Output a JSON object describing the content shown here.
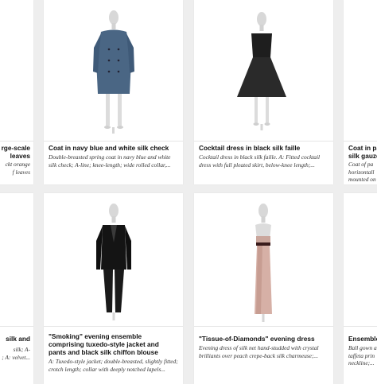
{
  "row1": [
    {
      "title": "rge-scale\nleaves",
      "desc": "ckt orange\nf leaves"
    },
    {
      "title": "Coat in navy blue and white silk check",
      "desc": "Double-breasted spring coat in navy blue and white silk check; A-line; knee-length; wide rolled collar,..."
    },
    {
      "title": "Cocktail dress in black silk faille",
      "desc": "Cocktail dress in black silk faille. A: Fitted cocktail dress with full pleated skirt, below-knee length;..."
    },
    {
      "title": "Coat in pa\nsilk gauze",
      "desc": "Coat of pa\nhorizontall\nmounted on"
    }
  ],
  "row2": [
    {
      "title": "silk and",
      "desc": "silk; A-\n; A: velvet..."
    },
    {
      "title": "\"Smoking\" evening ensemble comprising tuxedo-style jacket and pants and black silk chiffon blouse",
      "desc": "A: Tuxedo-style jacket; double-breasted, slightly fitted; crotch length; collar with deeply notched lapels..."
    },
    {
      "title": "\"Tissue-of-Diamonds\" evening dress",
      "desc": "Evening dress of silk net hand-studded with crystal brilliants over peach crepe-back silk charmeuse;..."
    },
    {
      "title": "Ensemble",
      "desc": "Ball gown a\ntaffeta prin\nneckline;..."
    }
  ]
}
